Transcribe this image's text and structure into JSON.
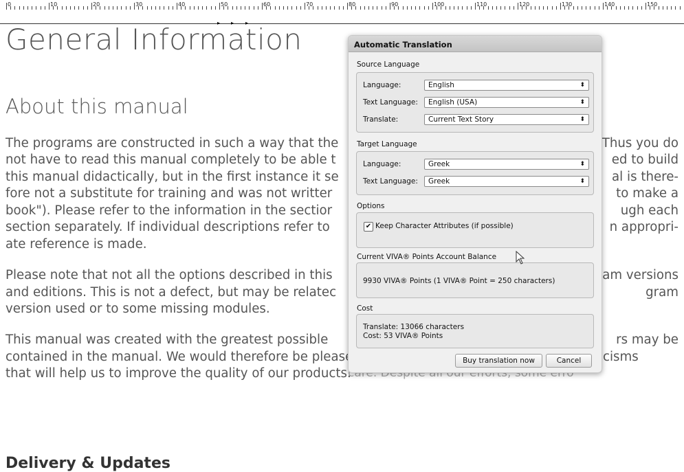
{
  "ruler": {
    "labels": [
      "0",
      "10",
      "20",
      "30",
      "40",
      "50",
      "60",
      "70",
      "80",
      "90",
      "100",
      "110",
      "120",
      "130",
      "140",
      "150"
    ]
  },
  "doc": {
    "title": "General Information",
    "section_heading": "About this manual",
    "paragraphs": [
      [
        "The programs are constructed in such a way that the",
        "Thus you do"
      ],
      [
        "not have to read this manual completely to be able t",
        "ed to build"
      ],
      [
        "this manual didactically, but in the first instance it se",
        "al is there-"
      ],
      [
        "fore not a substitute for training and was not writter",
        "to make a"
      ],
      [
        "book\"). Please refer to the information in the sectior",
        "ugh each"
      ],
      [
        "section separately. If individual descriptions refer to",
        "n appropri-"
      ],
      [
        "ate reference is made.",
        ""
      ],
      [
        "Please note that not all the options described in this",
        "am versions"
      ],
      [
        "and editions. This is not a defect, but may be relatec",
        "gram"
      ],
      [
        "version used or to some missing modules.",
        ""
      ],
      [
        "This manual was created with the greatest possible",
        "rs may be"
      ],
      [
        "contained in the manual. We would therefore be pleased to receive all your comments and criticisms",
        ""
      ],
      [
        "that will help us to improve the quality of our products.",
        ""
      ]
    ],
    "partial_line_fragment": "care. Despite all our efforts, some erro",
    "next_heading": "Delivery & Updates"
  },
  "dialog": {
    "title": "Automatic Translation",
    "source": {
      "label": "Source Language",
      "language_label": "Language:",
      "language_value": "English",
      "text_language_label": "Text Language:",
      "text_language_value": "English (USA)",
      "translate_label": "Translate:",
      "translate_value": "Current Text Story"
    },
    "target": {
      "label": "Target Language",
      "language_label": "Language:",
      "language_value": "Greek",
      "text_language_label": "Text Language:",
      "text_language_value": "Greek"
    },
    "options": {
      "label": "Options",
      "keep_attributes_label": "Keep Character Attributes (if possible)",
      "keep_attributes_checked": true
    },
    "balance": {
      "label": "Current VIVA® Points Account Balance",
      "text": "9930 VIVA® Points (1 VIVA® Point = 250 characters)"
    },
    "cost": {
      "label": "Cost",
      "translate_text": "Translate: 13066 characters",
      "cost_text": "Cost: 53 VIVA® Points"
    },
    "buttons": {
      "buy": "Buy translation now",
      "cancel": "Cancel"
    }
  }
}
